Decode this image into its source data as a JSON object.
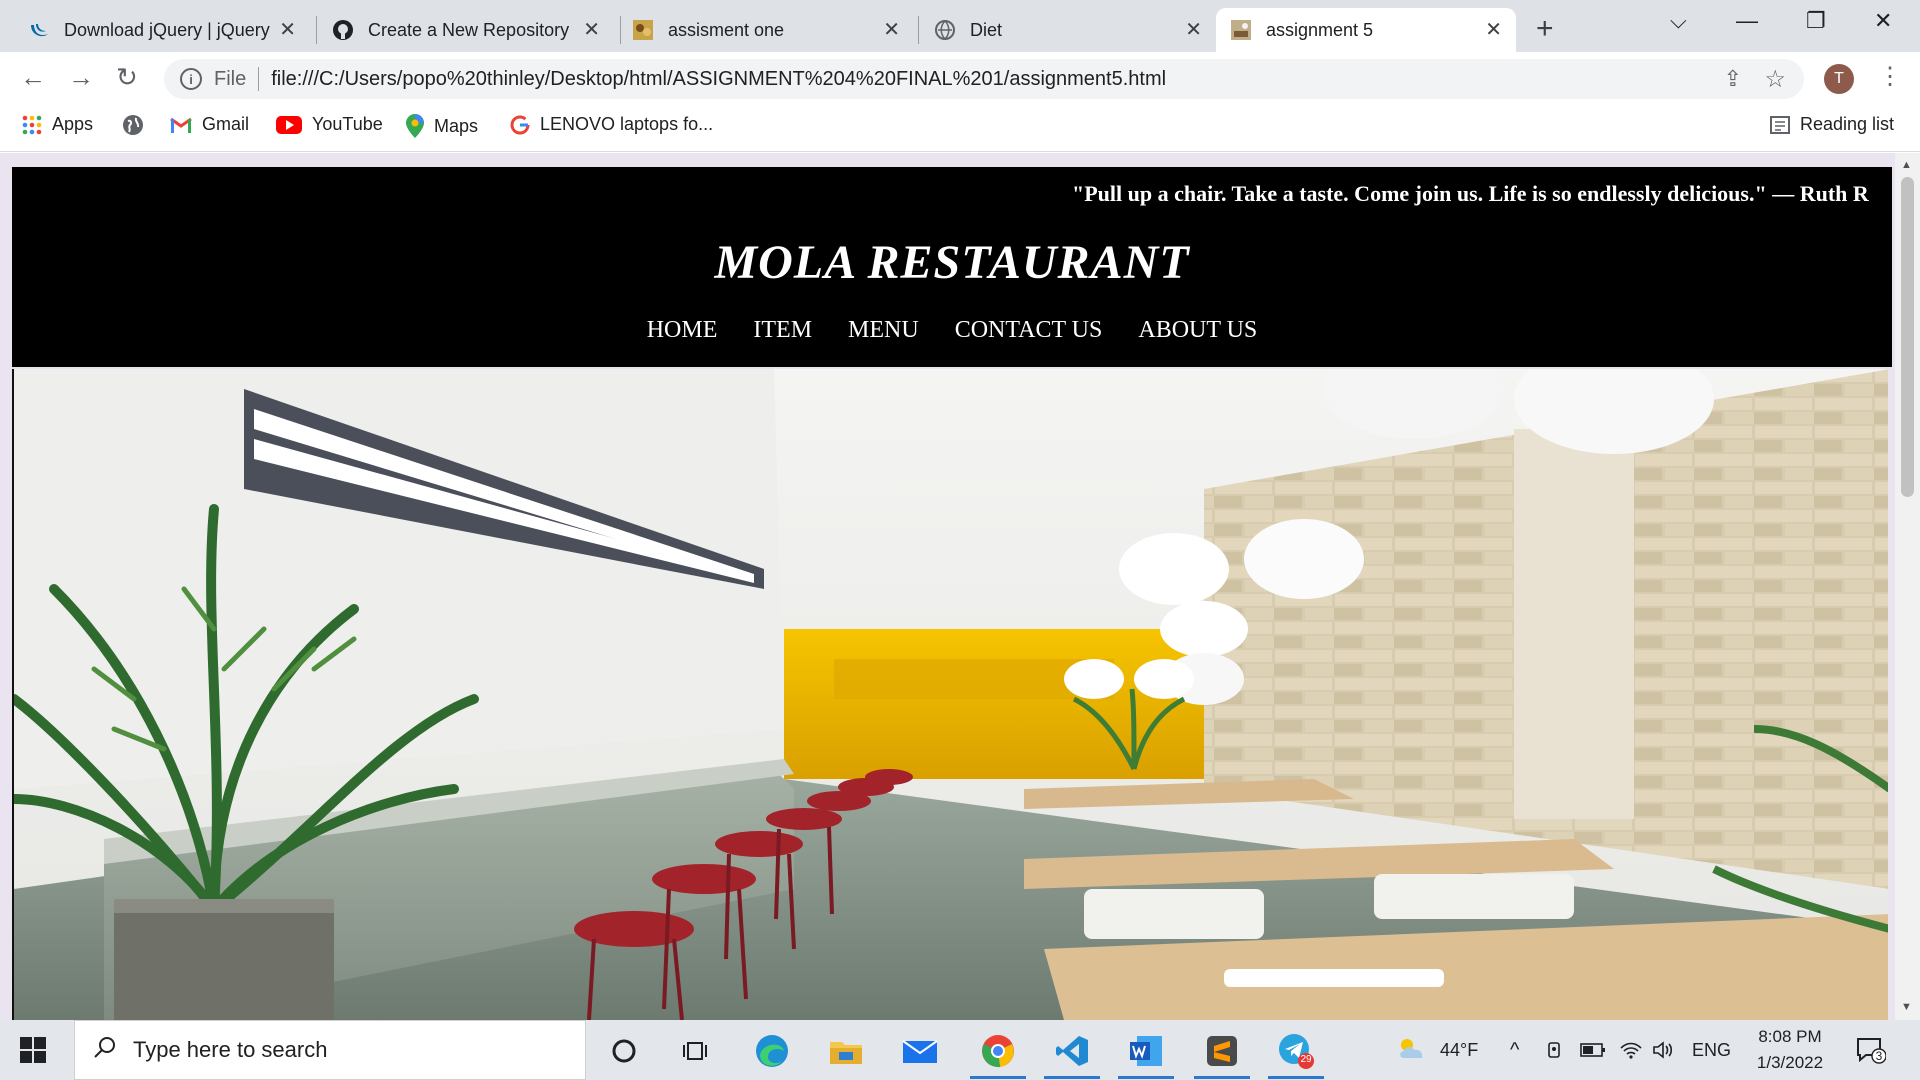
{
  "browser": {
    "tabs": [
      {
        "title": "Download jQuery | jQuery",
        "icon": "jquery-icon",
        "active": false
      },
      {
        "title": "Create a New Repository",
        "icon": "github-icon",
        "active": false
      },
      {
        "title": "assisment one",
        "icon": "tab-thumbnail-icon",
        "active": false
      },
      {
        "title": "Diet",
        "icon": "globe-icon",
        "active": false
      },
      {
        "title": "assignment 5",
        "icon": "tab-thumbnail-icon",
        "active": true
      }
    ],
    "address": {
      "scheme_label": "File",
      "url": "file:///C:/Users/popo%20thinley/Desktop/html/ASSIGNMENT%204%20FINAL%201/assignment5.html"
    },
    "profile_initial": "T",
    "bookmarks": [
      {
        "label": "Apps",
        "icon": "apps-grid-icon"
      },
      {
        "label": "",
        "icon": "globe-icon"
      },
      {
        "label": "Gmail",
        "icon": "gmail-icon"
      },
      {
        "label": "YouTube",
        "icon": "youtube-icon"
      },
      {
        "label": "Maps",
        "icon": "maps-pin-icon"
      },
      {
        "label": "LENOVO laptops fo...",
        "icon": "google-icon"
      }
    ],
    "reading_list_label": "Reading list"
  },
  "site": {
    "quote": "\"Pull up a chair. Take a taste. Come join us. Life is so endlessly delicious.\" — Ruth R",
    "title": "MOLA RESTAURANT",
    "nav": [
      "HOME",
      "ITEM",
      "MENU",
      "CONTACT US",
      "ABOUT US"
    ],
    "colors": {
      "header_bg": "#000000",
      "header_text": "#ffffff",
      "accent_yellow": "#f2b705"
    }
  },
  "taskbar": {
    "search_placeholder": "Type here to search",
    "weather": "44°F",
    "language": "ENG",
    "time": "8:08 PM",
    "date": "1/3/2022",
    "telegram_badge": "29",
    "notification_count": "3",
    "apps": [
      "cortana-icon",
      "task-view-icon",
      "edge-icon",
      "file-explorer-icon",
      "mail-icon",
      "chrome-icon",
      "vscode-icon",
      "word-icon",
      "sublime-icon",
      "telegram-icon"
    ]
  }
}
